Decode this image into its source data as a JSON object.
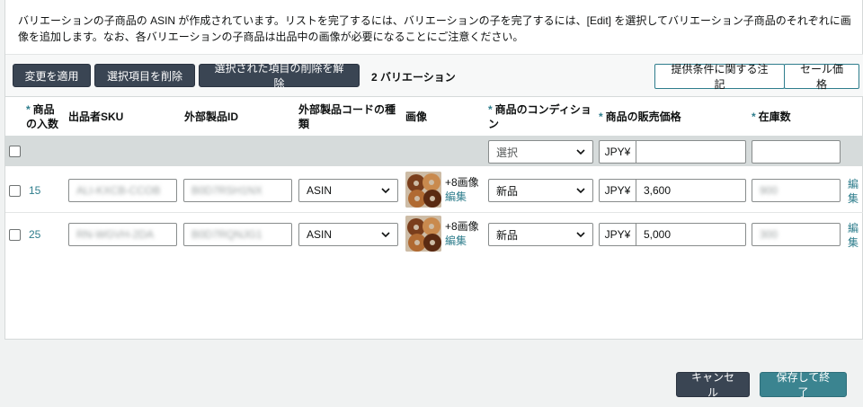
{
  "notice": "バリエーションの子商品の ASIN が作成されています。リストを完了するには、バリエーションの子を完了するには、[Edit] を選択してバリエーション子商品のそれぞれに画像を追加します。なお、各バリエーションの子商品は出品中の画像が必要になることにご注意ください。",
  "toolbar": {
    "apply_label": "変更を適用",
    "delete_label": "選択項目を削除",
    "undelete_label": "選択された項目の削除を解除",
    "variation_count": "2 バリエーション",
    "offer_notes_label": "提供条件に関する注記",
    "sale_price_label": "セール価格"
  },
  "columns": {
    "quantity_req": "*",
    "quantity_line1": "商品",
    "quantity_line2": "の入数",
    "sku": "出品者SKU",
    "external_id": "外部製品ID",
    "id_type_line1": "外部製品コードの種",
    "id_type_line2": "類",
    "image": "画像",
    "condition_req": "*",
    "condition_line1": "商品のコンディショ",
    "condition_line2": "ン",
    "price_req": "*",
    "price": "商品の販売価格",
    "stock_req": "*",
    "stock": "在庫数"
  },
  "filter": {
    "condition_placeholder": "選択",
    "currency": "JPY¥",
    "price_value": "",
    "stock_value": ""
  },
  "rows": [
    {
      "quantity": "15",
      "sku": "ALI-KXCB-CCOB",
      "external_id": "B0D7RSH1NX",
      "id_type": "ASIN",
      "image_extra": "+8画像",
      "edit_image": "編集",
      "condition": "新品",
      "currency": "JPY¥",
      "price": "3,600",
      "stock": "900",
      "edit_row_1": "編",
      "edit_row_2": "集"
    },
    {
      "quantity": "25",
      "sku": "RN-WGVH-2DA",
      "external_id": "B0D7RQNJG1",
      "id_type": "ASIN",
      "image_extra": "+8画像",
      "edit_image": "編集",
      "condition": "新品",
      "currency": "JPY¥",
      "price": "5,000",
      "stock": "300",
      "edit_row_1": "編",
      "edit_row_2": "集"
    }
  ],
  "footer": {
    "cancel_label": "キャンセル",
    "save_label": "保存して終了"
  },
  "colors": {
    "dark_button": "#3a4553",
    "accent_teal": "#2e7d8c",
    "save_button": "#3b8490"
  }
}
